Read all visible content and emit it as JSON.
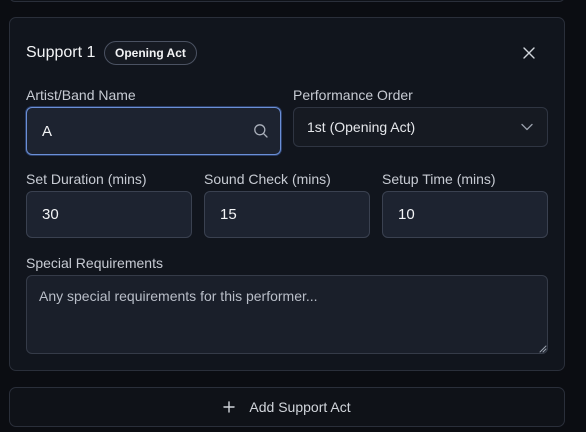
{
  "card": {
    "title": "Support 1",
    "badge": "Opening Act"
  },
  "fields": {
    "artist_label": "Artist/Band Name",
    "artist_value": "A",
    "order_label": "Performance Order",
    "order_value": "1st (Opening Act)",
    "set_label": "Set Duration (mins)",
    "set_value": "30",
    "sound_label": "Sound Check (mins)",
    "sound_value": "15",
    "setup_label": "Setup Time (mins)",
    "setup_value": "10",
    "requirements_label": "Special Requirements",
    "requirements_placeholder": "Any special requirements for this performer..."
  },
  "actions": {
    "add_label": "Add Support Act"
  },
  "icons": {
    "close": "close-icon",
    "search": "search-icon",
    "dropdown": "chevron-down-icon",
    "add": "plus-icon"
  },
  "colors": {
    "focus_border": "#6b8fd6",
    "background": "#0b0d12"
  }
}
